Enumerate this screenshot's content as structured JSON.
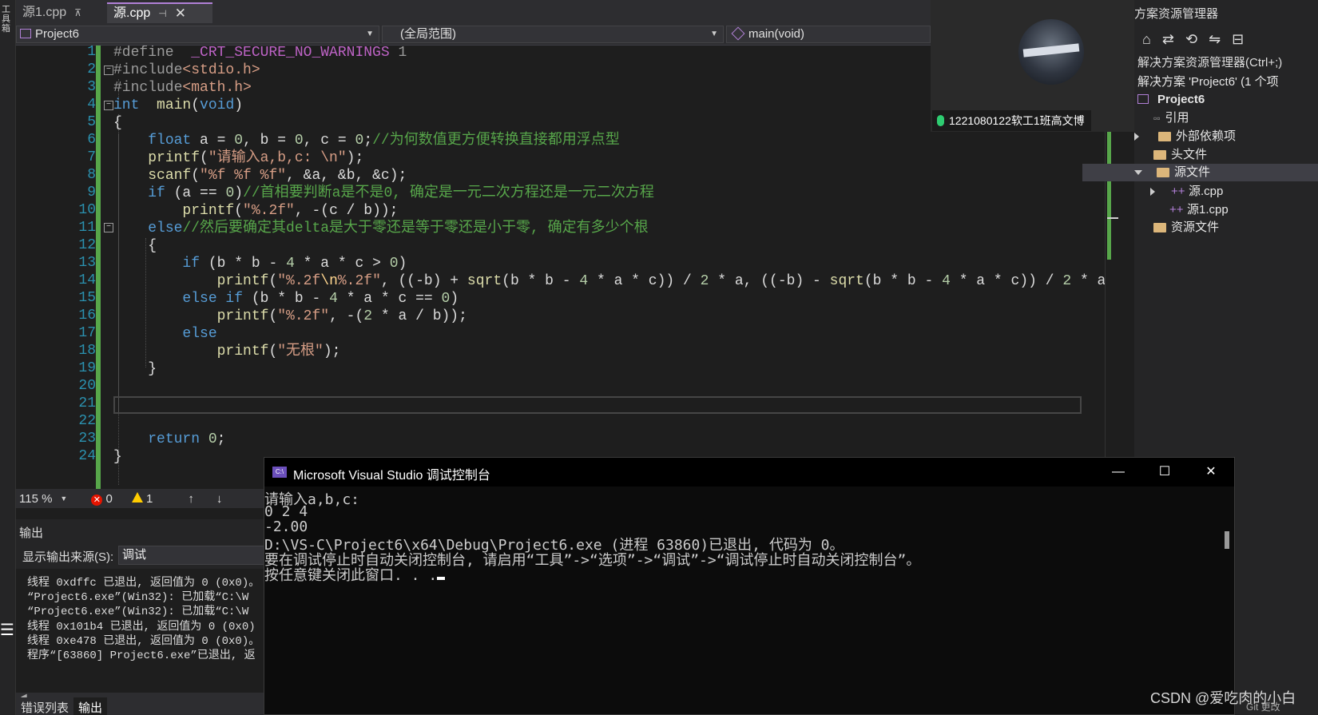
{
  "left_strip": {
    "label": "工具箱"
  },
  "tabs": [
    {
      "label": "源1.cpp",
      "pin": "⊼"
    },
    {
      "label": "源.cpp",
      "pin": "⊣",
      "close": "✕"
    }
  ],
  "nav": {
    "project": "Project6",
    "scope": "(全局范围)",
    "function": "main(void)"
  },
  "editor": {
    "line_numbers": [
      "1",
      "2",
      "3",
      "4",
      "5",
      "6",
      "7",
      "8",
      "9",
      "10",
      "11",
      "12",
      "13",
      "14",
      "15",
      "16",
      "17",
      "18",
      "19",
      "20",
      "21",
      "22",
      "23",
      "24"
    ],
    "lines": [
      {
        "t": [
          [
            "pp",
            "#define  "
          ],
          [
            "mac",
            "_CRT_SECURE_NO_WARNINGS"
          ],
          [
            "pp",
            " 1"
          ]
        ]
      },
      {
        "t": [
          [
            "pp",
            "#include"
          ],
          [
            "str",
            "<stdio.h>"
          ]
        ]
      },
      {
        "t": [
          [
            "pp",
            "#include"
          ],
          [
            "str",
            "<math.h>"
          ]
        ]
      },
      {
        "t": [
          [
            "kw",
            "int"
          ],
          [
            "",
            "  "
          ],
          [
            "fn",
            "main"
          ],
          [
            "",
            "("
          ],
          [
            "kw",
            "void"
          ],
          [
            "",
            ")"
          ]
        ]
      },
      {
        "t": [
          [
            "",
            "{"
          ]
        ]
      },
      {
        "t": [
          [
            "",
            "    "
          ],
          [
            "kw",
            "float"
          ],
          [
            "",
            " a = "
          ],
          [
            "num",
            "0"
          ],
          [
            "",
            ", b = "
          ],
          [
            "num",
            "0"
          ],
          [
            "",
            ", c = "
          ],
          [
            "num",
            "0"
          ],
          [
            "",
            ";"
          ],
          [
            "cm",
            "//为何数值更方便转换直接都用浮点型"
          ]
        ]
      },
      {
        "t": [
          [
            "",
            "    "
          ],
          [
            "fn",
            "printf"
          ],
          [
            "",
            "("
          ],
          [
            "str",
            "\"请输入a,b,c: \\n\""
          ],
          [
            "",
            ");"
          ]
        ]
      },
      {
        "t": [
          [
            "",
            "    "
          ],
          [
            "fn",
            "scanf"
          ],
          [
            "",
            "("
          ],
          [
            "str",
            "\"%f %f %f\""
          ],
          [
            "",
            ", &a, &b, &c);"
          ]
        ]
      },
      {
        "t": [
          [
            "",
            "    "
          ],
          [
            "kw",
            "if"
          ],
          [
            "",
            " (a == "
          ],
          [
            "num",
            "0"
          ],
          [
            "",
            ")"
          ],
          [
            "cm",
            "//首相要判断a是不是0, 确定是一元二次方程还是一元二次方程"
          ]
        ]
      },
      {
        "t": [
          [
            "",
            "        "
          ],
          [
            "fn",
            "printf"
          ],
          [
            "",
            "("
          ],
          [
            "str",
            "\"%.2f\""
          ],
          [
            "",
            ", -(c / b));"
          ]
        ]
      },
      {
        "t": [
          [
            "",
            "    "
          ],
          [
            "kw",
            "else"
          ],
          [
            "cm",
            "//然后要确定其delta是大于零还是等于零还是小于零, 确定有多少个根"
          ]
        ]
      },
      {
        "t": [
          [
            "",
            "    {"
          ]
        ]
      },
      {
        "t": [
          [
            "",
            "        "
          ],
          [
            "kw",
            "if"
          ],
          [
            "",
            " (b * b - "
          ],
          [
            "num",
            "4"
          ],
          [
            "",
            " * a * c > "
          ],
          [
            "num",
            "0"
          ],
          [
            "",
            ")"
          ]
        ]
      },
      {
        "t": [
          [
            "",
            "            "
          ],
          [
            "fn",
            "printf"
          ],
          [
            "",
            "("
          ],
          [
            "str",
            "\"%.2f"
          ],
          [
            "esc",
            "\\n"
          ],
          [
            "str",
            "%.2f\""
          ],
          [
            "",
            ", ((-b) + "
          ],
          [
            "fn",
            "sqrt"
          ],
          [
            "",
            "(b * b - "
          ],
          [
            "num",
            "4"
          ],
          [
            "",
            " * a * c)) / "
          ],
          [
            "num",
            "2"
          ],
          [
            "",
            " * a, ((-b) - "
          ],
          [
            "fn",
            "sqrt"
          ],
          [
            "",
            "(b * b - "
          ],
          [
            "num",
            "4"
          ],
          [
            "",
            " * a * c)) / "
          ],
          [
            "num",
            "2"
          ],
          [
            "",
            " * a);"
          ]
        ]
      },
      {
        "t": [
          [
            "",
            "        "
          ],
          [
            "kw",
            "else if"
          ],
          [
            "",
            " (b * b - "
          ],
          [
            "num",
            "4"
          ],
          [
            "",
            " * a * c == "
          ],
          [
            "num",
            "0"
          ],
          [
            "",
            ")"
          ]
        ]
      },
      {
        "t": [
          [
            "",
            "            "
          ],
          [
            "fn",
            "printf"
          ],
          [
            "",
            "("
          ],
          [
            "str",
            "\"%.2f\""
          ],
          [
            "",
            ", -("
          ],
          [
            "num",
            "2"
          ],
          [
            "",
            " * a / b));"
          ]
        ]
      },
      {
        "t": [
          [
            "",
            "        "
          ],
          [
            "kw",
            "else"
          ]
        ]
      },
      {
        "t": [
          [
            "",
            "            "
          ],
          [
            "fn",
            "printf"
          ],
          [
            "",
            "("
          ],
          [
            "str",
            "\"无根\""
          ],
          [
            "",
            ");"
          ]
        ]
      },
      {
        "t": [
          [
            "",
            "    }"
          ]
        ]
      },
      {
        "t": []
      },
      {
        "t": []
      },
      {
        "t": []
      },
      {
        "t": [
          [
            "",
            "    "
          ],
          [
            "kw",
            "return"
          ],
          [
            "",
            " "
          ],
          [
            "num",
            "0"
          ],
          [
            "",
            ";"
          ]
        ]
      },
      {
        "t": [
          [
            "",
            "}"
          ]
        ]
      }
    ]
  },
  "status": {
    "zoom": "115 %",
    "errors": "0",
    "warnings": "1",
    "up": "↑",
    "down": "↓"
  },
  "output": {
    "title": "输出",
    "source_label": "显示输出来源(S):",
    "source_value": "调试",
    "log": [
      "线程 0xdffc 已退出, 返回值为 0 (0x0)。",
      "“Project6.exe”(Win32): 已加载“C:\\W",
      "“Project6.exe”(Win32): 已加载“C:\\W",
      "线程 0x101b4 已退出, 返回值为 0 (0x0)",
      "线程 0xe478 已退出, 返回值为 0 (0x0)。",
      "程序“[63860] Project6.exe”已退出, 返"
    ]
  },
  "bottom_tabs": [
    "错误列表",
    "输出"
  ],
  "video": {
    "label": "1221080122软工1班高文博"
  },
  "solution_explorer": {
    "title": "方案资源管理器",
    "search": "解决方案资源管理器(Ctrl+;)",
    "solution": "解决方案 'Project6' (1 个项",
    "project": "Project6",
    "refs": "引用",
    "external": "外部依赖项",
    "headers": "头文件",
    "sources": "源文件",
    "file1": "源.cpp",
    "file2": "源1.cpp",
    "resources": "资源文件"
  },
  "console": {
    "title": "Microsoft Visual Studio 调试控制台",
    "minimize": "—",
    "maximize": "☐",
    "close": "✕",
    "lines": [
      "请输入a,b,c:",
      "0 2 4",
      "-2.00",
      "D:\\VS-C\\Project6\\x64\\Debug\\Project6.exe (进程 63860)已退出, 代码为 0。",
      "要在调试停止时自动关闭控制台, 请启用“工具”->“选项”->“调试”->“调试停止时自动关闭控制台”。",
      "按任意键关闭此窗口. . ."
    ]
  },
  "watermark": "CSDN @爱吃肉的小白",
  "git": "Git 更改"
}
